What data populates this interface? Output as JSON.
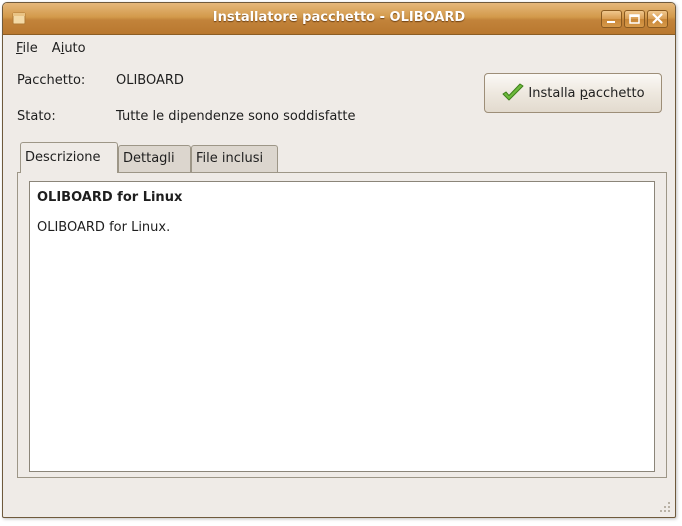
{
  "window": {
    "title": "Installatore pacchetto - OLIBOARD"
  },
  "menu": {
    "file": {
      "mnemonic": "F",
      "rest": "ile"
    },
    "help": {
      "pre": "A",
      "mnemonic": "i",
      "rest": "uto"
    }
  },
  "info": {
    "package_label": "Pacchetto:",
    "package_value": "OLIBOARD",
    "status_label": "Stato:",
    "status_value": "Tutte le dipendenze sono soddisfatte"
  },
  "install_button": {
    "label_pre": "Installa ",
    "label_mnemonic": "p",
    "label_rest": "acchetto",
    "icon": "checkmark-icon"
  },
  "tabs": [
    {
      "label": "Descrizione",
      "active": true
    },
    {
      "label": "Dettagli",
      "active": false
    },
    {
      "label": "File inclusi",
      "active": false
    }
  ],
  "description": {
    "title": "OLIBOARD for Linux",
    "body": "OLIBOARD for Linux."
  },
  "colors": {
    "titlebar": "#d39a4b",
    "window_bg": "#efebe7",
    "check_green": "#5aa532"
  }
}
